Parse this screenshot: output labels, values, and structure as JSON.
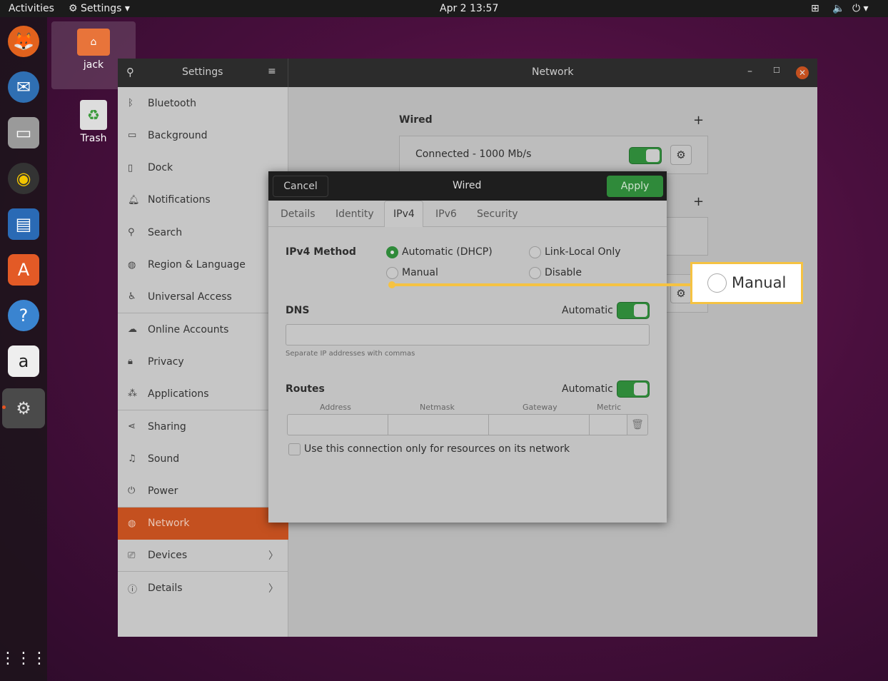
{
  "topbar": {
    "activities": "Activities",
    "app_menu": "Settings",
    "clock": "Apr 2  13:57"
  },
  "desktop": {
    "home_label": "jack",
    "trash_label": "Trash"
  },
  "dock": {
    "apps": [
      "firefox",
      "thunderbird",
      "files",
      "rhythmbox",
      "libreoffice-writer",
      "software",
      "help",
      "amazon",
      "settings"
    ]
  },
  "window": {
    "sidebar_title": "Settings",
    "title": "Network"
  },
  "sidebar": {
    "items": [
      {
        "label": "Bluetooth",
        "icon": "bluetooth-icon"
      },
      {
        "label": "Background",
        "icon": "background-icon"
      },
      {
        "label": "Dock",
        "icon": "dock-icon"
      },
      {
        "label": "Notifications",
        "icon": "bell-icon"
      },
      {
        "label": "Search",
        "icon": "search-icon"
      },
      {
        "label": "Region & Language",
        "icon": "globe-icon"
      },
      {
        "label": "Universal Access",
        "icon": "accessibility-icon"
      },
      {
        "label": "Online Accounts",
        "icon": "cloud-icon"
      },
      {
        "label": "Privacy",
        "icon": "lock-icon"
      },
      {
        "label": "Applications",
        "icon": "applications-icon"
      },
      {
        "label": "Sharing",
        "icon": "share-icon"
      },
      {
        "label": "Sound",
        "icon": "music-note-icon"
      },
      {
        "label": "Power",
        "icon": "power-icon"
      },
      {
        "label": "Network",
        "icon": "network-icon",
        "selected": true
      },
      {
        "label": "Devices",
        "icon": "devices-icon"
      },
      {
        "label": "Details",
        "icon": "info-icon"
      }
    ]
  },
  "network": {
    "wired_heading": "Wired",
    "wired_status": "Connected - 1000 Mb/s",
    "wired_on": true
  },
  "dialog": {
    "title": "Wired",
    "cancel": "Cancel",
    "apply": "Apply",
    "tabs": [
      "Details",
      "Identity",
      "IPv4",
      "IPv6",
      "Security"
    ],
    "active_tab": "IPv4",
    "method_label": "IPv4 Method",
    "methods": {
      "dhcp": "Automatic (DHCP)",
      "link_local": "Link-Local Only",
      "manual": "Manual",
      "disable": "Disable"
    },
    "selected_method": "Automatic (DHCP)",
    "dns_label": "DNS",
    "dns_auto_label": "Automatic",
    "dns_auto": true,
    "dns_value": "",
    "dns_hint": "Separate IP addresses with commas",
    "routes_label": "Routes",
    "routes_auto_label": "Automatic",
    "routes_auto": true,
    "route_columns": [
      "Address",
      "Netmask",
      "Gateway",
      "Metric"
    ],
    "only_resources_label": "Use this connection only for resources on its network",
    "only_resources": false
  },
  "callout": {
    "label": "Manual",
    "color": "#f5c242"
  },
  "colors": {
    "accent": "#c4501f",
    "toggle_on": "#2f8a3a"
  }
}
